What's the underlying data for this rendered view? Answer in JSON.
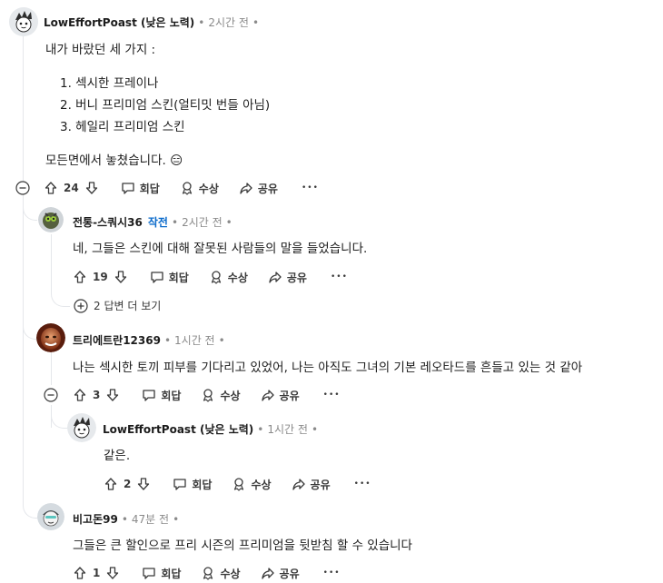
{
  "comments": [
    {
      "username": "LowEffortPoast (낮은 노력)",
      "time": "2시간 전",
      "intro": "내가 바랐던 세 가지 :",
      "list": [
        "1. 섹시한 프레이나",
        "2. 버니 프리미엄 스킨(얼티밋 번들 아님)",
        "3. 헤일리 프리미엄 스킨"
      ],
      "closing": "모든면에서 놓쳤습니다. 😑",
      "votes": "24"
    },
    {
      "username": "전통-스쿼시36",
      "flair": "작전",
      "time": "2시간 전",
      "body": "네, 그들은 스킨에 대해 잘못된 사람들의 말을 들었습니다.",
      "votes": "19",
      "more_replies": "2 답변 더 보기"
    },
    {
      "username": "트리에트란12369",
      "time": "1시간 전",
      "body": "나는 섹시한 토끼 피부를 기다리고 있었어, 나는 아직도 그녀의 기본 레오타드를 흔들고 있는 것 같아",
      "votes": "3"
    },
    {
      "username": "LowEffortPoast (낮은 노력)",
      "time": "1시간 전",
      "body": "같은.",
      "votes": "2"
    },
    {
      "username": "비고돈99",
      "time": "47분 전",
      "body": "그들은 큰 할인으로 프리 시즌의 프리미엄을 뒷받침 할 수 있습니다",
      "votes": "1"
    }
  ],
  "actions": {
    "reply": "회답",
    "award": "수상",
    "share": "공유",
    "more": "•••"
  },
  "icons": [
    "upvote-icon",
    "downvote-icon",
    "reply-icon",
    "award-icon",
    "share-icon",
    "collapse-icon",
    "expand-icon"
  ]
}
